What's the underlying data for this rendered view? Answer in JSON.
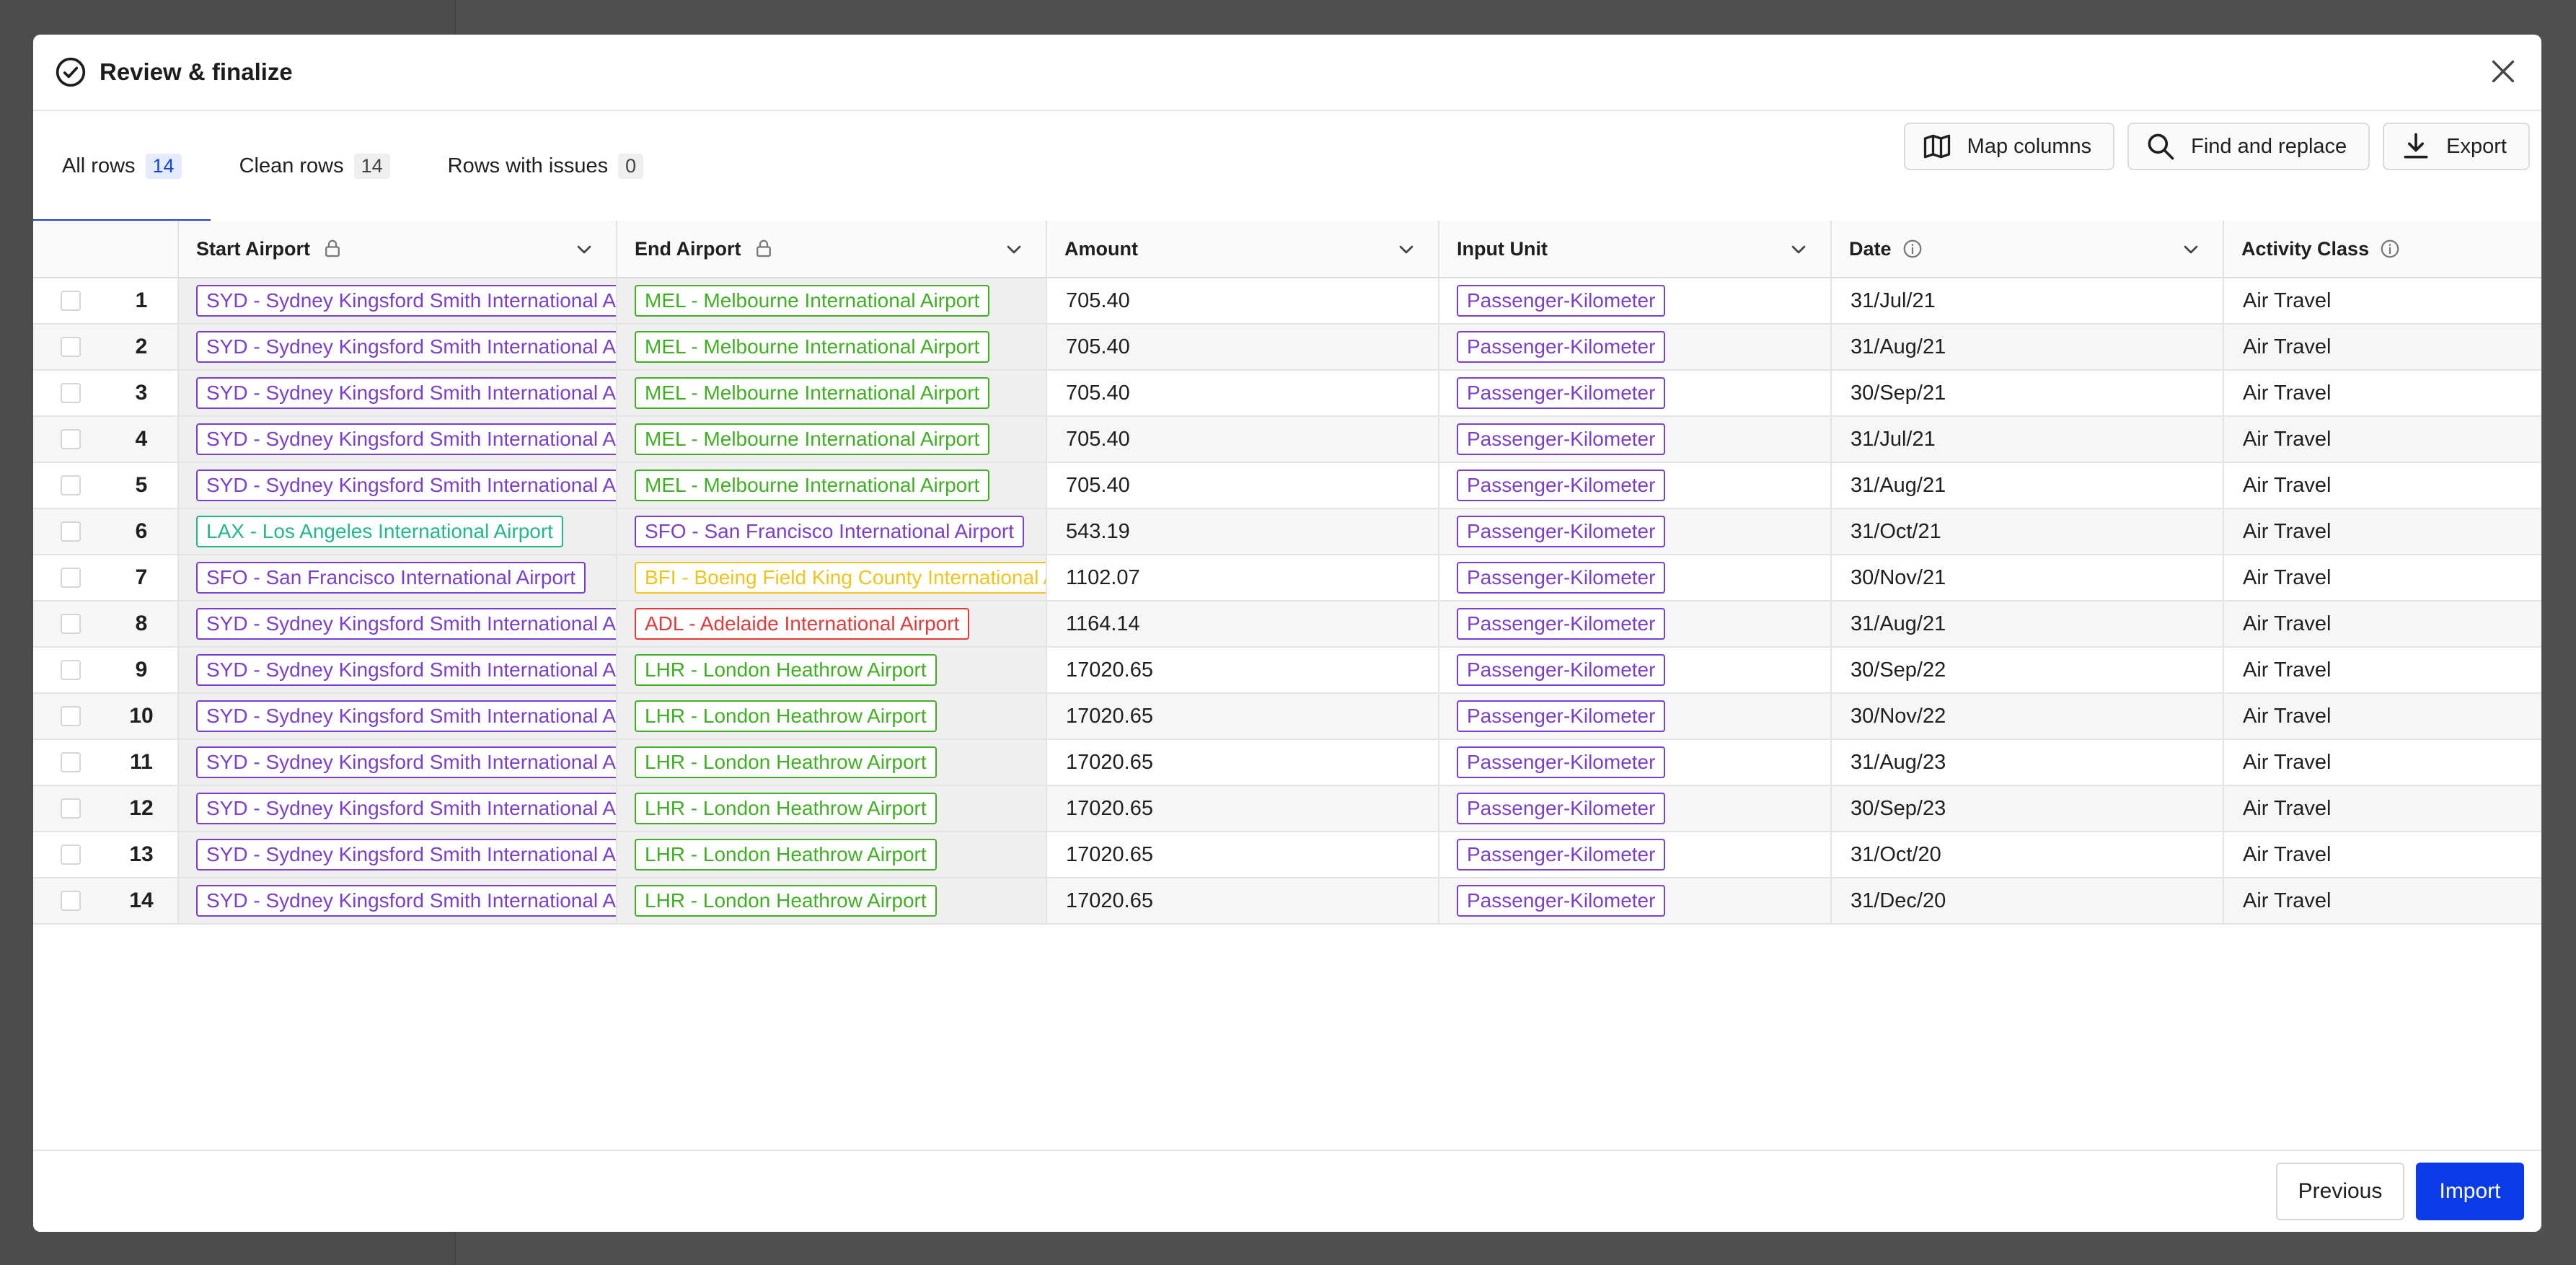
{
  "modal": {
    "title": "Review & finalize"
  },
  "tabs": [
    {
      "label": "All rows",
      "count": "14"
    },
    {
      "label": "Clean rows",
      "count": "14"
    },
    {
      "label": "Rows with issues",
      "count": "0"
    }
  ],
  "actions": {
    "map_columns": "Map columns",
    "find_replace": "Find and replace",
    "export": "Export"
  },
  "columns": {
    "start_airport": "Start Airport",
    "end_airport": "End Airport",
    "amount": "Amount",
    "input_unit": "Input Unit",
    "date": "Date",
    "activity_class": "Activity Class"
  },
  "colors": {
    "purple": "#7a3fd0",
    "green": "#3fb021",
    "teal": "#1fb88a",
    "yellow": "#f0c419",
    "red": "#e53a3a",
    "accent": "#0b3be8"
  },
  "rows": [
    {
      "num": "1",
      "start": "SYD - Sydney Kingsford Smith International Airport",
      "start_color": "purple",
      "end": "MEL - Melbourne International Airport",
      "end_color": "green",
      "amount": "705.40",
      "unit": "Passenger-Kilometer",
      "date": "31/Jul/21",
      "activity": "Air Travel"
    },
    {
      "num": "2",
      "start": "SYD - Sydney Kingsford Smith International Airport",
      "start_color": "purple",
      "end": "MEL - Melbourne International Airport",
      "end_color": "green",
      "amount": "705.40",
      "unit": "Passenger-Kilometer",
      "date": "31/Aug/21",
      "activity": "Air Travel"
    },
    {
      "num": "3",
      "start": "SYD - Sydney Kingsford Smith International Airport",
      "start_color": "purple",
      "end": "MEL - Melbourne International Airport",
      "end_color": "green",
      "amount": "705.40",
      "unit": "Passenger-Kilometer",
      "date": "30/Sep/21",
      "activity": "Air Travel"
    },
    {
      "num": "4",
      "start": "SYD - Sydney Kingsford Smith International Airport",
      "start_color": "purple",
      "end": "MEL - Melbourne International Airport",
      "end_color": "green",
      "amount": "705.40",
      "unit": "Passenger-Kilometer",
      "date": "31/Jul/21",
      "activity": "Air Travel"
    },
    {
      "num": "5",
      "start": "SYD - Sydney Kingsford Smith International Airport",
      "start_color": "purple",
      "end": "MEL - Melbourne International Airport",
      "end_color": "green",
      "amount": "705.40",
      "unit": "Passenger-Kilometer",
      "date": "31/Aug/21",
      "activity": "Air Travel"
    },
    {
      "num": "6",
      "start": "LAX - Los Angeles International Airport",
      "start_color": "teal",
      "end": "SFO - San Francisco International Airport",
      "end_color": "purple",
      "amount": "543.19",
      "unit": "Passenger-Kilometer",
      "date": "31/Oct/21",
      "activity": "Air Travel"
    },
    {
      "num": "7",
      "start": "SFO - San Francisco International Airport",
      "start_color": "purple",
      "end": "BFI - Boeing Field King County International Airport",
      "end_color": "yellow",
      "amount": "1102.07",
      "unit": "Passenger-Kilometer",
      "date": "30/Nov/21",
      "activity": "Air Travel"
    },
    {
      "num": "8",
      "start": "SYD - Sydney Kingsford Smith International Airport",
      "start_color": "purple",
      "end": "ADL - Adelaide International Airport",
      "end_color": "red",
      "amount": "1164.14",
      "unit": "Passenger-Kilometer",
      "date": "31/Aug/21",
      "activity": "Air Travel"
    },
    {
      "num": "9",
      "start": "SYD - Sydney Kingsford Smith International Airport",
      "start_color": "purple",
      "end": "LHR - London Heathrow Airport",
      "end_color": "green",
      "amount": "17020.65",
      "unit": "Passenger-Kilometer",
      "date": "30/Sep/22",
      "activity": "Air Travel"
    },
    {
      "num": "10",
      "start": "SYD - Sydney Kingsford Smith International Airport",
      "start_color": "purple",
      "end": "LHR - London Heathrow Airport",
      "end_color": "green",
      "amount": "17020.65",
      "unit": "Passenger-Kilometer",
      "date": "30/Nov/22",
      "activity": "Air Travel"
    },
    {
      "num": "11",
      "start": "SYD - Sydney Kingsford Smith International Airport",
      "start_color": "purple",
      "end": "LHR - London Heathrow Airport",
      "end_color": "green",
      "amount": "17020.65",
      "unit": "Passenger-Kilometer",
      "date": "31/Aug/23",
      "activity": "Air Travel"
    },
    {
      "num": "12",
      "start": "SYD - Sydney Kingsford Smith International Airport",
      "start_color": "purple",
      "end": "LHR - London Heathrow Airport",
      "end_color": "green",
      "amount": "17020.65",
      "unit": "Passenger-Kilometer",
      "date": "30/Sep/23",
      "activity": "Air Travel"
    },
    {
      "num": "13",
      "start": "SYD - Sydney Kingsford Smith International Airport",
      "start_color": "purple",
      "end": "LHR - London Heathrow Airport",
      "end_color": "green",
      "amount": "17020.65",
      "unit": "Passenger-Kilometer",
      "date": "31/Oct/20",
      "activity": "Air Travel"
    },
    {
      "num": "14",
      "start": "SYD - Sydney Kingsford Smith International Airport",
      "start_color": "purple",
      "end": "LHR - London Heathrow Airport",
      "end_color": "green",
      "amount": "17020.65",
      "unit": "Passenger-Kilometer",
      "date": "31/Dec/20",
      "activity": "Air Travel"
    }
  ],
  "footer": {
    "previous": "Previous",
    "import": "Import"
  }
}
